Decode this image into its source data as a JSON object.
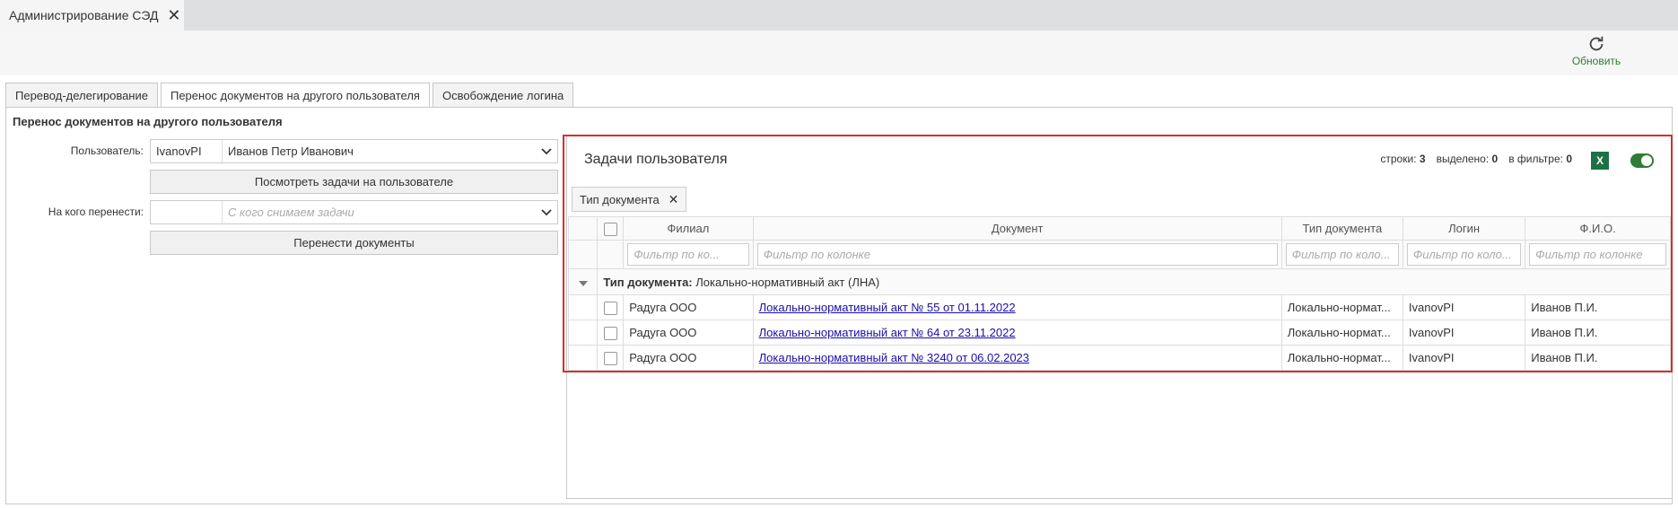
{
  "window": {
    "tab_title": "Администрирование СЭД"
  },
  "toolbar": {
    "refresh_label": "Обновить"
  },
  "tabs": [
    {
      "label": "Перевод-делегирование"
    },
    {
      "label": "Перенос документов на другого пользователя"
    },
    {
      "label": "Освобождение логина"
    }
  ],
  "form": {
    "title": "Перенос документов на другого пользователя",
    "user_label": "Пользователь:",
    "user_code": "IvanovPI",
    "user_name": "Иванов Петр Иванович",
    "view_tasks_button": "Посмотреть задачи на пользователе",
    "target_label": "На кого перенести:",
    "target_placeholder": "С кого снимаем задачи",
    "transfer_button": "Перенести документы"
  },
  "grid": {
    "title": "Задачи пользователя",
    "stats": {
      "rows_label": "строки:",
      "rows": "3",
      "selected_label": "выделено:",
      "selected": "0",
      "filter_label": "в фильтре:",
      "filter": "0"
    },
    "excel_label": "X",
    "group_chip": "Тип документа",
    "columns": [
      "Филиал",
      "Документ",
      "Тип документа",
      "Логин",
      "Ф.И.О."
    ],
    "filter_placeholders": [
      "Фильтр по ко...",
      "Фильтр по колонке",
      "Фильтр по коло...",
      "Фильтр по коло...",
      "Фильтр по колонке"
    ],
    "group": {
      "label": "Тип документа:",
      "value": "Локально-нормативный акт (ЛНА)"
    },
    "rows": [
      {
        "branch": "Радуга ООО",
        "document": "Локально-нормативный акт № 55 от 01.11.2022",
        "doc_type": "Локально-нормат...",
        "login": "IvanovPI",
        "fio": "Иванов П.И."
      },
      {
        "branch": "Радуга ООО",
        "document": "Локально-нормативный акт № 64 от 23.11.2022",
        "doc_type": "Локально-нормат...",
        "login": "IvanovPI",
        "fio": "Иванов П.И."
      },
      {
        "branch": "Радуга ООО",
        "document": "Локально-нормативный акт № 3240 от 06.02.2023",
        "doc_type": "Локально-нормат...",
        "login": "IvanovPI",
        "fio": "Иванов П.И."
      }
    ]
  },
  "colors": {
    "accent_green": "#2e7d32",
    "excel_green": "#1e7145",
    "highlight_red": "#d32f2f",
    "link_blue": "#1a0dab"
  }
}
